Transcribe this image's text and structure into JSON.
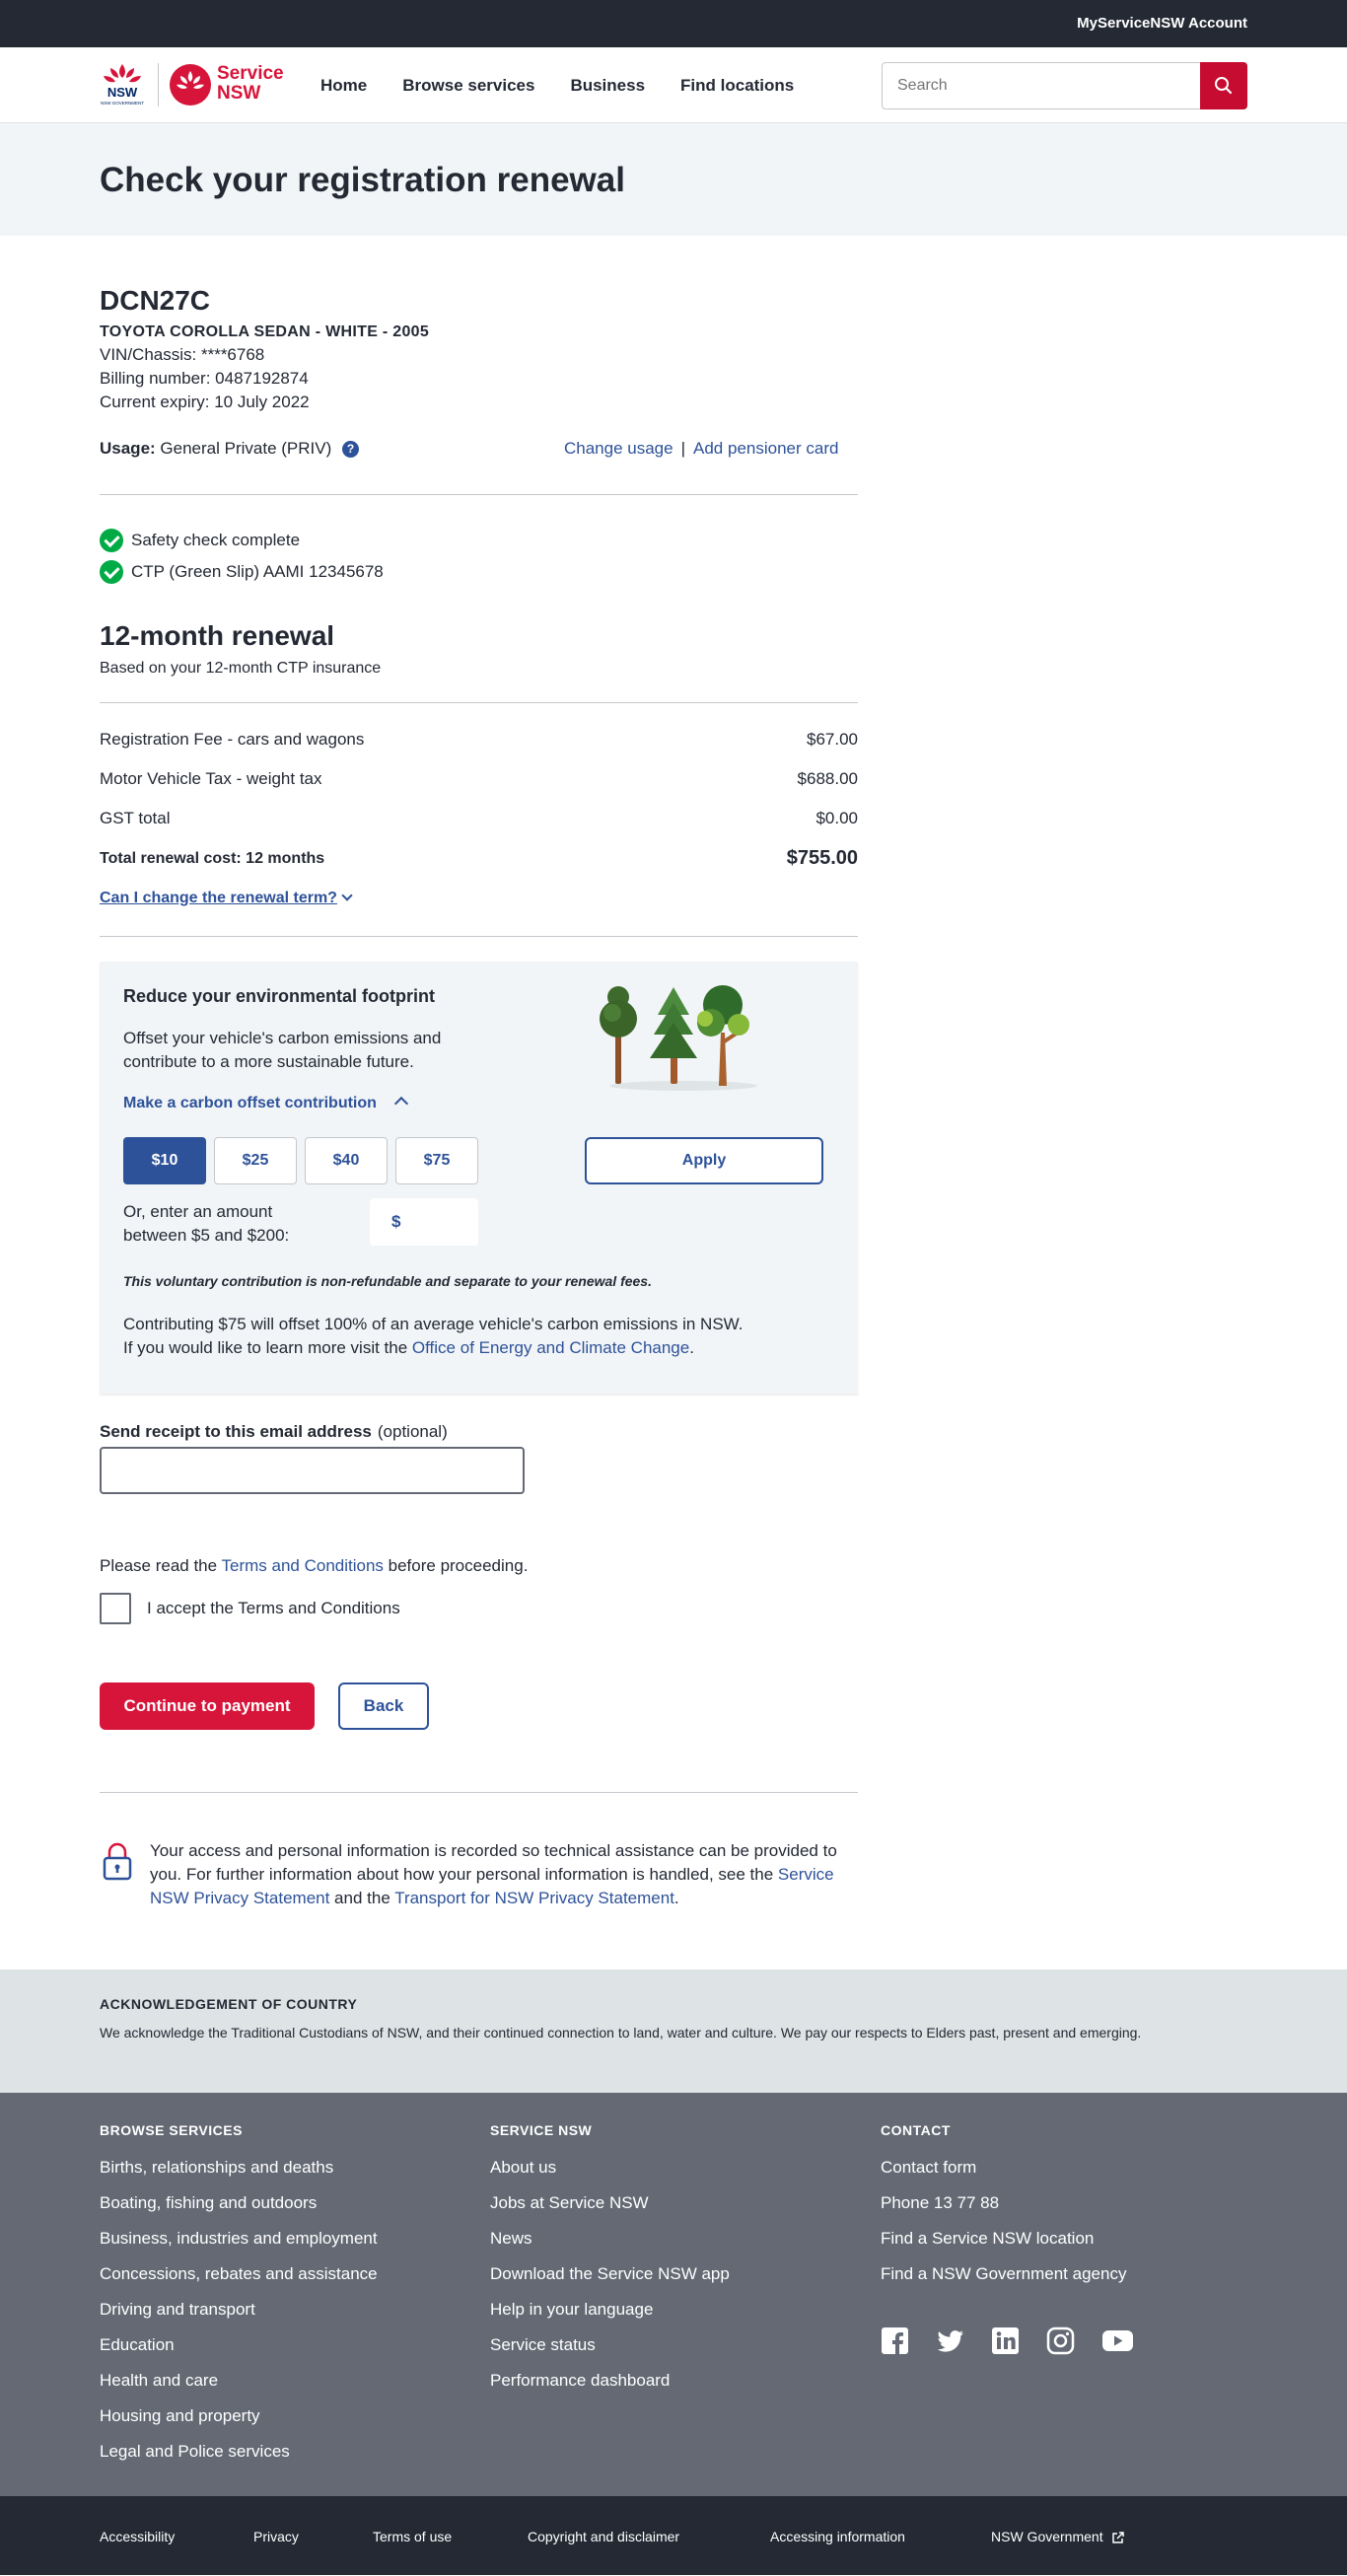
{
  "topbar": {
    "account": "MyServiceNSW Account"
  },
  "header": {
    "logo_nsw": "NSW GOVERNMENT",
    "logo_service_line1": "Service",
    "logo_service_line2": "NSW",
    "nav": [
      "Home",
      "Browse services",
      "Business",
      "Find locations"
    ],
    "search_placeholder": "Search"
  },
  "page": {
    "title": "Check your registration renewal"
  },
  "vehicle": {
    "plate": "DCN27C",
    "description": "TOYOTA COROLLA SEDAN - WHITE - 2005",
    "vin": "VIN/Chassis: ****6768",
    "billing": "Billing number: 0487192874",
    "expiry": "Current expiry: 10 July 2022",
    "usage_label": "Usage:",
    "usage_value": "General Private (PRIV)",
    "help": "?",
    "change_usage": "Change usage",
    "separator": "|",
    "add_pensioner": "Add pensioner card"
  },
  "checks": [
    "Safety check complete",
    "CTP (Green Slip) AAMI 12345678"
  ],
  "renewal": {
    "title": "12-month renewal",
    "subtitle": "Based on your 12-month CTP insurance",
    "fees": [
      {
        "label": "Registration Fee - cars and wagons",
        "amount": "$67.00"
      },
      {
        "label": "Motor Vehicle Tax - weight tax",
        "amount": "$688.00"
      },
      {
        "label": "GST total",
        "amount": "$0.00"
      }
    ],
    "total_label": "Total renewal cost: 12 months",
    "total_amount": "$755.00",
    "change_term": "Can I change the renewal term?"
  },
  "carbon": {
    "title": "Reduce your environmental footprint",
    "text": "Offset your vehicle's carbon emissions and contribute to a more sustainable future.",
    "toggle": "Make a carbon offset contribution",
    "amounts": [
      "$10",
      "$25",
      "$40",
      "$75"
    ],
    "selected": "$10",
    "apply": "Apply",
    "or_text": "Or, enter an amount between $5 and $200:",
    "dollar_prefix": "$",
    "note": "This voluntary contribution is non-refundable and separate to your renewal fees.",
    "footer_line1": "Contributing $75 will offset 100% of an average vehicle's carbon emissions in NSW.",
    "footer_line2_pre": "If you would like to learn more visit the ",
    "footer_link": "Office of Energy and Climate Change",
    "footer_line2_post": "."
  },
  "email": {
    "label": "Send receipt to this email address",
    "optional": "(optional)",
    "value": ""
  },
  "terms": {
    "pre": "Please read the ",
    "link": "Terms and Conditions",
    "post": " before proceeding.",
    "checkbox_label": "I accept the Terms and Conditions"
  },
  "actions": {
    "continue": "Continue to payment",
    "back": "Back"
  },
  "privacy": {
    "text": "Your access and personal information is recorded so technical assistance can be provided to you. For further information about how your personal information is handled, see the ",
    "link1": "Service NSW Privacy Statement",
    "mid": " and the ",
    "link2": "Transport for NSW Privacy Statement",
    "end": "."
  },
  "acknowledgement": {
    "title": "ACKNOWLEDGEMENT OF COUNTRY",
    "text": "We acknowledge the Traditional Custodians of NSW, and their continued connection to land, water and culture. We pay our respects to Elders past, present and emerging."
  },
  "footer": {
    "browse": {
      "title": "BROWSE SERVICES",
      "links": [
        "Births, relationships and deaths",
        "Boating, fishing and outdoors",
        "Business, industries and employment",
        "Concessions, rebates and assistance",
        "Driving and transport",
        "Education",
        "Health and care",
        "Housing and property",
        "Legal and Police services"
      ]
    },
    "service": {
      "title": "SERVICE NSW",
      "links": [
        "About us",
        "Jobs at Service NSW",
        "News",
        "Download the Service NSW app",
        "Help in your language",
        "Service status",
        "Performance dashboard"
      ]
    },
    "contact": {
      "title": "CONTACT",
      "links": [
        "Contact form",
        "Phone 13 77 88",
        "Find a Service NSW location",
        "Find a NSW Government agency"
      ]
    },
    "social_icons": [
      "facebook-icon",
      "twitter-icon",
      "linkedin-icon",
      "instagram-icon",
      "youtube-icon"
    ]
  },
  "bottombar": [
    "Accessibility",
    "Privacy",
    "Terms of use",
    "Copyright and disclaimer",
    "Accessing information",
    "NSW Government"
  ],
  "colors": {
    "brand_red": "#d7153a",
    "brand_blue": "#2e5299",
    "dark": "#242934",
    "success": "#00aa45"
  }
}
